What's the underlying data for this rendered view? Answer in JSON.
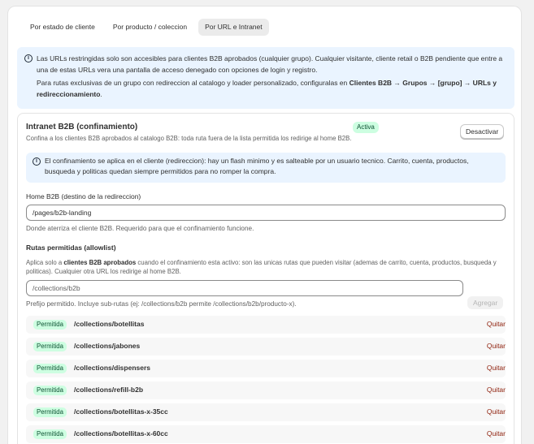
{
  "tabs": [
    {
      "label": "Por estado de cliente",
      "active": false
    },
    {
      "label": "Por producto / coleccion",
      "active": false
    },
    {
      "label": "Por URL e Intranet",
      "active": true
    }
  ],
  "info_banner": {
    "icon": "info-icon",
    "p1": "Las URLs restringidas solo son accesibles para clientes B2B aprobados (cualquier grupo). Cualquier visitante, cliente retail o B2B pendiente que entre a una de estas URLs vera una pantalla de acceso denegado con opciones de login y registro.",
    "p2_prefix": "Para rutas exclusivas de un grupo con redireccion al catalogo y loader personalizado, configuralas en ",
    "p2_link": "Clientes B2B → Grupos → [grupo] → URLs y redireccionamiento",
    "p2_suffix": "."
  },
  "intranet": {
    "title": "Intranet B2B (confinamiento)",
    "status": "Activa",
    "deactivate_label": "Desactivar",
    "description": "Confina a los clientes B2B aprobados al catalogo B2B: toda ruta fuera de la lista permitida los redirige al home B2B.",
    "notice": "El confinamiento se aplica en el cliente (redireccion): hay un flash minimo y es salteable por un usuario tecnico. Carrito, cuenta, productos, busqueda y politicas quedan siempre permitidos para no romper la compra.",
    "home": {
      "label": "Home B2B (destino de la redireccion)",
      "value": "/pages/b2b-landing",
      "help": "Donde aterriza el cliente B2B. Requerido para que el confinamiento funcione."
    },
    "allowlist": {
      "label": "Rutas permitidas (allowlist)",
      "desc_prefix": "Aplica solo a ",
      "desc_bold": "clientes B2B aprobados",
      "desc_suffix": " cuando el confinamiento esta activo: son las unicas rutas que pueden visitar (ademas de carrito, cuenta, productos, busqueda y politicas). Cualquier otra URL los redirige al home B2B.",
      "placeholder": "/collections/b2b",
      "help": "Prefijo permitido. Incluye sub-rutas (ej: /collections/b2b permite /collections/b2b/producto-x).",
      "add_label": "Agregar",
      "items": [
        {
          "status": "Permitida",
          "path": "/collections/botellitas",
          "action": "Quitar"
        },
        {
          "status": "Permitida",
          "path": "/collections/jabones",
          "action": "Quitar"
        },
        {
          "status": "Permitida",
          "path": "/collections/dispensers",
          "action": "Quitar"
        },
        {
          "status": "Permitida",
          "path": "/collections/refill-b2b",
          "action": "Quitar"
        },
        {
          "status": "Permitida",
          "path": "/collections/botellitas-x-35cc",
          "action": "Quitar"
        },
        {
          "status": "Permitida",
          "path": "/collections/botellitas-x-60cc",
          "action": "Quitar"
        }
      ]
    }
  }
}
